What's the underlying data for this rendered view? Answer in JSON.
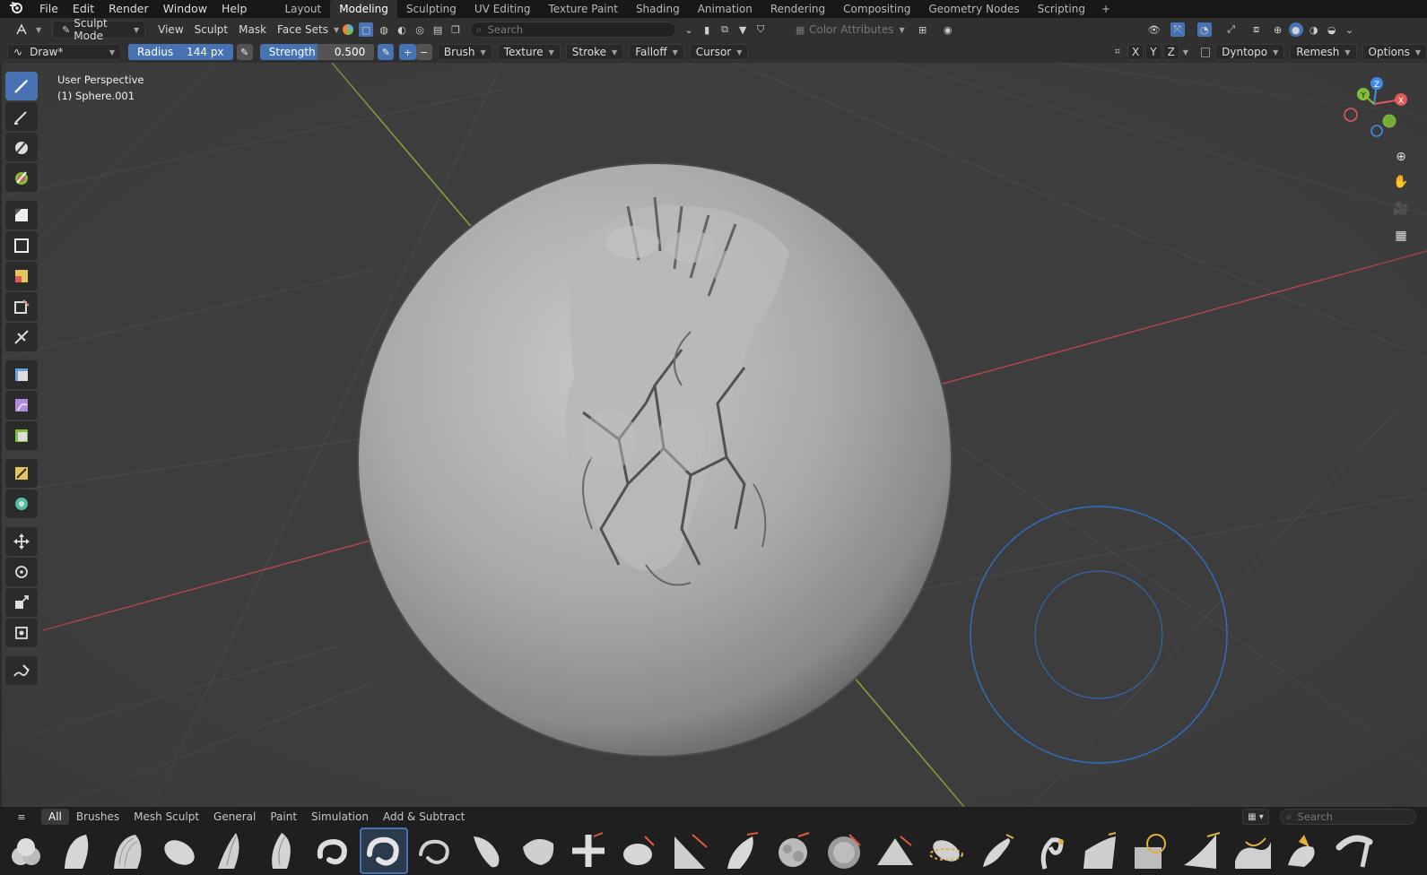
{
  "menu": {
    "logo": "blender-logo",
    "items": [
      "File",
      "Edit",
      "Render",
      "Window",
      "Help"
    ]
  },
  "workspaces": {
    "tabs": [
      "Layout",
      "Modeling",
      "Sculpting",
      "UV Editing",
      "Texture Paint",
      "Shading",
      "Animation",
      "Rendering",
      "Compositing",
      "Geometry Nodes",
      "Scripting"
    ],
    "active": "Modeling",
    "add_icon": "+"
  },
  "header": {
    "mode": "Sculpt Mode",
    "menus": [
      "View",
      "Sculpt",
      "Mask",
      "Face Sets"
    ],
    "search_placeholder": "Search",
    "color_attributes": "Color Attributes"
  },
  "tool_settings": {
    "brush_name": "Draw*",
    "radius_label": "Radius",
    "radius_value": "144 px",
    "strength_label": "Strength",
    "strength_value": "0.500",
    "plus": "+",
    "minus": "−",
    "dropdowns": [
      "Brush",
      "Texture",
      "Stroke",
      "Falloff",
      "Cursor"
    ],
    "axes": [
      "X",
      "Y",
      "Z"
    ],
    "dyntopo": "Dyntopo",
    "remesh": "Remesh",
    "options": "Options"
  },
  "viewport": {
    "perspective": "User Perspective",
    "object": "(1) Sphere.001",
    "gizmo_axes": [
      "X",
      "Y",
      "Z"
    ],
    "colors": {
      "x_axis": "#e05a5a",
      "y_axis": "#7fbf3a",
      "z_axis": "#3f8ce8",
      "background": "#3d3d3d",
      "accent": "#4772b3"
    }
  },
  "asset_shelf": {
    "categories": [
      "All",
      "Brushes",
      "Mesh Sculpt",
      "General",
      "Paint",
      "Simulation",
      "Add & Subtract"
    ],
    "active_category": "All",
    "search_placeholder": "Search",
    "active_brush_index": 7
  }
}
